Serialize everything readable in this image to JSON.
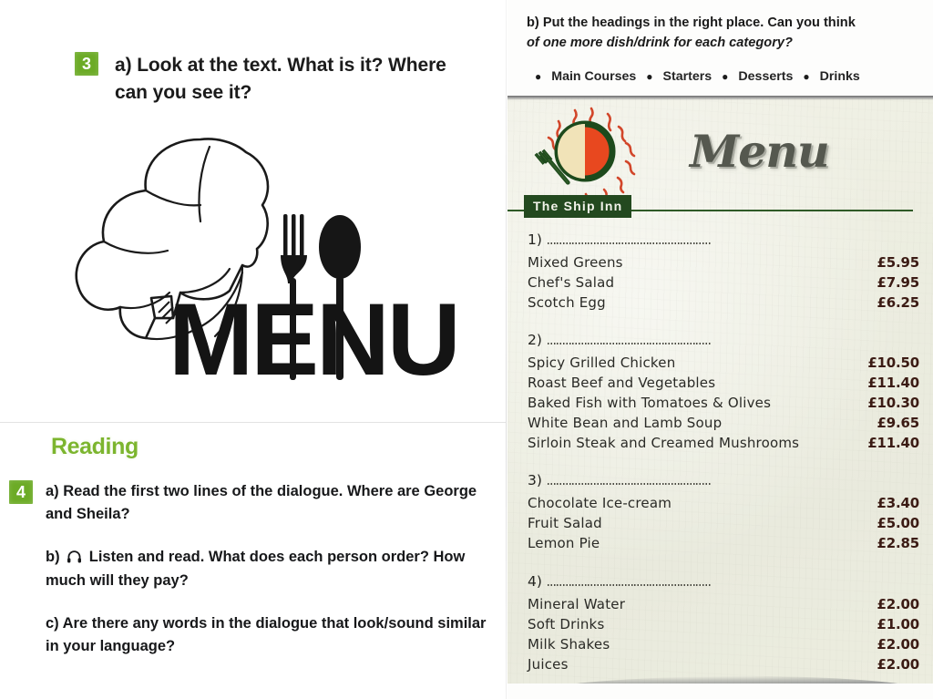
{
  "left": {
    "exercise3": {
      "number": "3",
      "question": "a) Look at the text. What is it? Where can you see it?"
    },
    "illustration": {
      "word": "MENU",
      "hat_icon": "chef-hat-icon",
      "fork_icon": "fork-icon",
      "spoon_icon": "spoon-icon"
    },
    "reading_heading": "Reading",
    "exercise4": {
      "number": "4",
      "part_a": "a) Read the first two lines of the dialogue. Where are George and Sheila?",
      "part_b_prefix": "b)",
      "part_b_icon": "headphones-icon",
      "part_b": "Listen and read. What does each person order? How much will they pay?",
      "part_c": "c) Are there any words in the dialogue that look/sound similar in your language?"
    }
  },
  "right": {
    "instruction_line1": "b) Put the headings in the right place. Can you think",
    "instruction_line2": "of one more dish/drink for each category?",
    "categories": [
      "Main Courses",
      "Starters",
      "Desserts",
      "Drinks"
    ],
    "card": {
      "logo_name": "sun-plate-fork-logo",
      "title": "Menu",
      "restaurant": "The Ship Inn",
      "sections": [
        {
          "number": "1)",
          "heading_blank": "",
          "items": [
            {
              "name": "Mixed Greens",
              "price": "£5.95"
            },
            {
              "name": "Chef's Salad",
              "price": "£7.95"
            },
            {
              "name": "Scotch Egg",
              "price": "£6.25"
            }
          ]
        },
        {
          "number": "2)",
          "heading_blank": "",
          "items": [
            {
              "name": "Spicy Grilled Chicken",
              "price": "£10.50"
            },
            {
              "name": "Roast Beef and Vegetables",
              "price": "£11.40"
            },
            {
              "name": "Baked Fish with Tomatoes & Olives",
              "price": "£10.30"
            },
            {
              "name": "White Bean and Lamb Soup",
              "price": "£9.65"
            },
            {
              "name": "Sirloin Steak and Creamed Mushrooms",
              "price": "£11.40"
            }
          ]
        },
        {
          "number": "3)",
          "heading_blank": "",
          "items": [
            {
              "name": "Chocolate Ice-cream",
              "price": "£3.40"
            },
            {
              "name": "Fruit Salad",
              "price": "£5.00"
            },
            {
              "name": "Lemon Pie",
              "price": "£2.85"
            }
          ]
        },
        {
          "number": "4)",
          "heading_blank": "",
          "items": [
            {
              "name": "Mineral Water",
              "price": "£2.00"
            },
            {
              "name": "Soft Drinks",
              "price": "£1.00"
            },
            {
              "name": "Milk Shakes",
              "price": "£2.00"
            },
            {
              "name": "Juices",
              "price": "£2.00"
            }
          ]
        }
      ]
    }
  },
  "colors": {
    "exercise_number_green": "#6cab26",
    "reading_green": "#7cb52e",
    "badge_green": "#23491f",
    "price_maroon": "#3b1b14",
    "card_cream": "#edeee1",
    "logo_orange": "#e8481f"
  }
}
